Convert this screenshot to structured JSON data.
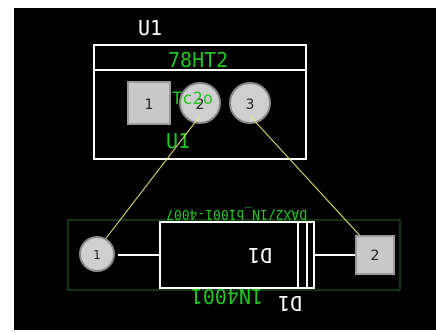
{
  "board": {
    "colors": {
      "background": "#000000",
      "silkscreen_white": "#ffffff",
      "silkscreen_green": "#25c425",
      "copper_pad": "#c8c8c8",
      "ratsnest": "#e8e86a",
      "courtyard": "#1f6b1f"
    }
  },
  "u1": {
    "designator_top": "U1",
    "value": "78HT2",
    "overlay_text": "Tc2o",
    "designator_bottom": "U1",
    "pads": [
      {
        "number": "1",
        "shape": "square"
      },
      {
        "number": "2",
        "shape": "round"
      },
      {
        "number": "3",
        "shape": "round"
      }
    ]
  },
  "d1": {
    "mirrored_part_text": "DAX2/1N_b1001-4007",
    "body_designator": "D1",
    "value": "1N4001",
    "designator": "D1",
    "pads": [
      {
        "number": "1",
        "shape": "round"
      },
      {
        "number": "2",
        "shape": "square"
      }
    ]
  }
}
